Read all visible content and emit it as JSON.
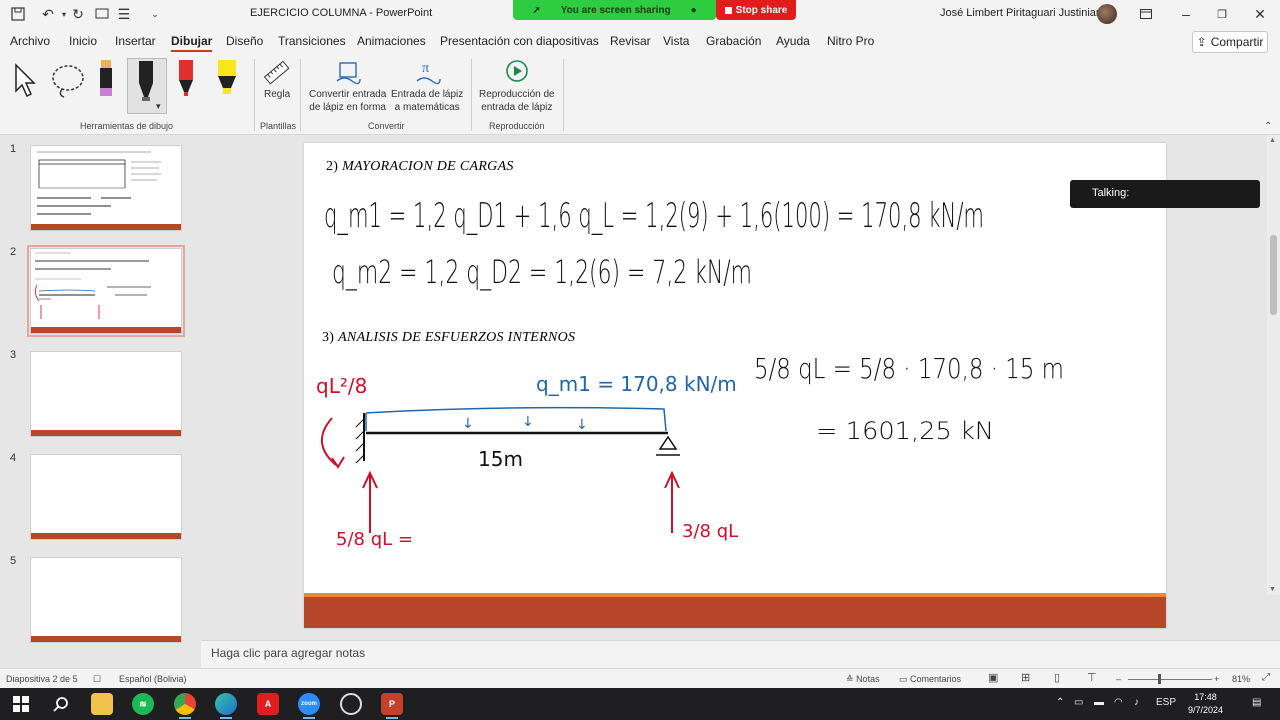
{
  "titlebar": {
    "document_title": "EJERCICIO COLUMNA  -  PowerPoint",
    "share_status": "You are screen sharing",
    "stop_share_label": "Stop share",
    "user_name": "José Limbert Piritaguari Justiniano"
  },
  "menu": {
    "tabs": [
      "Archivo",
      "Inicio",
      "Insertar",
      "Dibujar",
      "Diseño",
      "Transiciones",
      "Animaciones",
      "Presentación con diapositivas",
      "Revisar",
      "Vista",
      "Grabación",
      "Ayuda",
      "Nitro Pro"
    ],
    "active_tab": "Dibujar",
    "share_label": "Compartir"
  },
  "ribbon": {
    "groups": {
      "drawing_tools": "Herramientas de dibujo",
      "stencils": "Plantillas",
      "convert": "Convertir",
      "replay": "Reproducción"
    },
    "buttons": {
      "ruler": "Regla",
      "ink_to_shape": [
        "Convertir entrada",
        "de lápiz en forma"
      ],
      "ink_to_math": [
        "Entrada de lápiz",
        "a matemáticas"
      ],
      "ink_replay": [
        "Reproducción de",
        "entrada de lápiz"
      ]
    },
    "pen_colors": [
      "#c97fd3",
      "#222222",
      "#e03030",
      "#f7e61c"
    ]
  },
  "thumbnails": [
    {
      "number": "1",
      "selected": false
    },
    {
      "number": "2",
      "selected": true
    },
    {
      "number": "3",
      "selected": false
    },
    {
      "number": "4",
      "selected": false
    },
    {
      "number": "5",
      "selected": false
    }
  ],
  "slide": {
    "heading1_num": "2)",
    "heading1": "MAYORACION DE CARGAS",
    "heading2_num": "3)",
    "heading2": "ANALISIS DE ESFUERZOS INTERNOS",
    "ink_eq1": "q_m1 = 1,2 q_D1 + 1,6 q_L = 1,2(9) + 1,6(100) = 170,8 kN/m",
    "ink_eq2": "q_m2 = 1,2 q_D2 = 1,2(6) = 7,2 kN/m",
    "ink_load_label": "q_m1 = 170,8 kN/m",
    "ink_span": "15m",
    "ink_moment": "qL²/8",
    "ink_left_reaction": "5/8 qL =",
    "ink_right_reaction": "3/8 qL",
    "ink_calc1": "5/8 qL = 5/8 · 170,8 · 15 m",
    "ink_calc2": "= 1601,25 kN",
    "band_color": "#b7472a",
    "ink_blue": "#2266aa",
    "ink_red": "#d0102a"
  },
  "overlay": {
    "talking_label": "Talking:"
  },
  "notes": {
    "placeholder": "Haga clic para agregar notas"
  },
  "statusbar": {
    "slide_indicator": "Diapositiva 2 de 5",
    "language": "Español (Bolivia)",
    "notes_label": "Notas",
    "comments_label": "Comentarios",
    "zoom": "81%"
  },
  "taskbar": {
    "language": "ESP",
    "time": "17:48",
    "date": "9/7/2024",
    "zoom_app_label": "zoom"
  }
}
